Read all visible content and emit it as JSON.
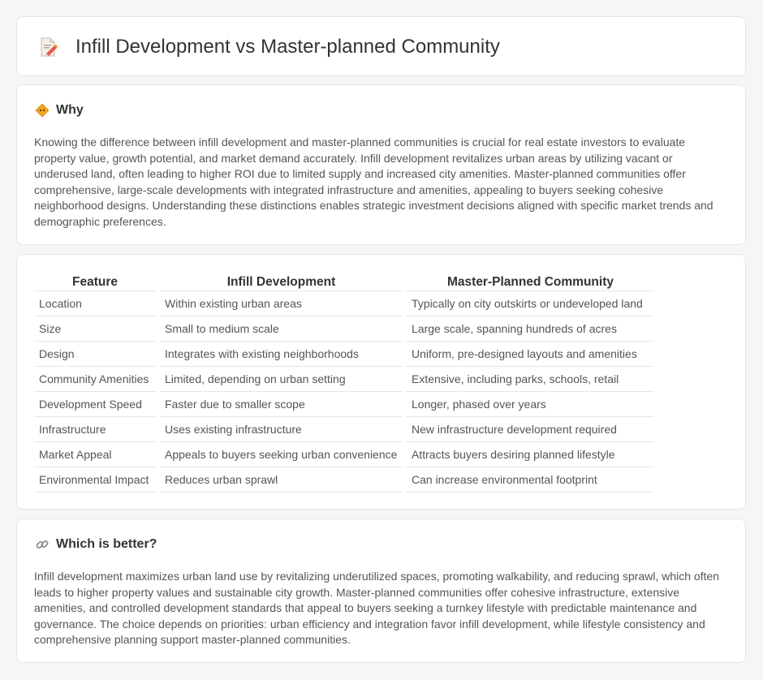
{
  "page": {
    "title": "Infill Development vs Master-planned Community"
  },
  "why": {
    "heading": "Why",
    "text": "Knowing the difference between infill development and master-planned communities is crucial for real estate investors to evaluate property value, growth potential, and market demand accurately. Infill development revitalizes urban areas by utilizing vacant or underused land, often leading to higher ROI due to limited supply and increased city amenities. Master-planned communities offer comprehensive, large-scale developments with integrated infrastructure and amenities, appealing to buyers seeking cohesive neighborhood designs. Understanding these distinctions enables strategic investment decisions aligned with specific market trends and demographic preferences."
  },
  "table": {
    "headers": [
      "Feature",
      "Infill Development",
      "Master-Planned Community"
    ],
    "rows": [
      [
        "Location",
        "Within existing urban areas",
        "Typically on city outskirts or undeveloped land"
      ],
      [
        "Size",
        "Small to medium scale",
        "Large scale, spanning hundreds of acres"
      ],
      [
        "Design",
        "Integrates with existing neighborhoods",
        "Uniform, pre-designed layouts and amenities"
      ],
      [
        "Community Amenities",
        "Limited, depending on urban setting",
        "Extensive, including parks, schools, retail"
      ],
      [
        "Development Speed",
        "Faster due to smaller scope",
        "Longer, phased over years"
      ],
      [
        "Infrastructure",
        "Uses existing infrastructure",
        "New infrastructure development required"
      ],
      [
        "Market Appeal",
        "Appeals to buyers seeking urban convenience",
        "Attracts buyers desiring planned lifestyle"
      ],
      [
        "Environmental Impact",
        "Reduces urban sprawl",
        "Can increase environmental footprint"
      ]
    ]
  },
  "better": {
    "heading": "Which is better?",
    "text": "Infill development maximizes urban land use by revitalizing underutilized spaces, promoting walkability, and reducing sprawl, which often leads to higher property values and sustainable city growth. Master-planned communities offer cohesive infrastructure, extensive amenities, and controlled development standards that appeal to buyers seeking a turnkey lifestyle with predictable maintenance and governance. The choice depends on priorities: urban efficiency and integration favor infill development, while lifestyle consistency and comprehensive planning support master-planned communities."
  },
  "icons": {
    "title": "document-pencil-icon",
    "why": "diamond-sign-icon",
    "better": "link-icon"
  }
}
